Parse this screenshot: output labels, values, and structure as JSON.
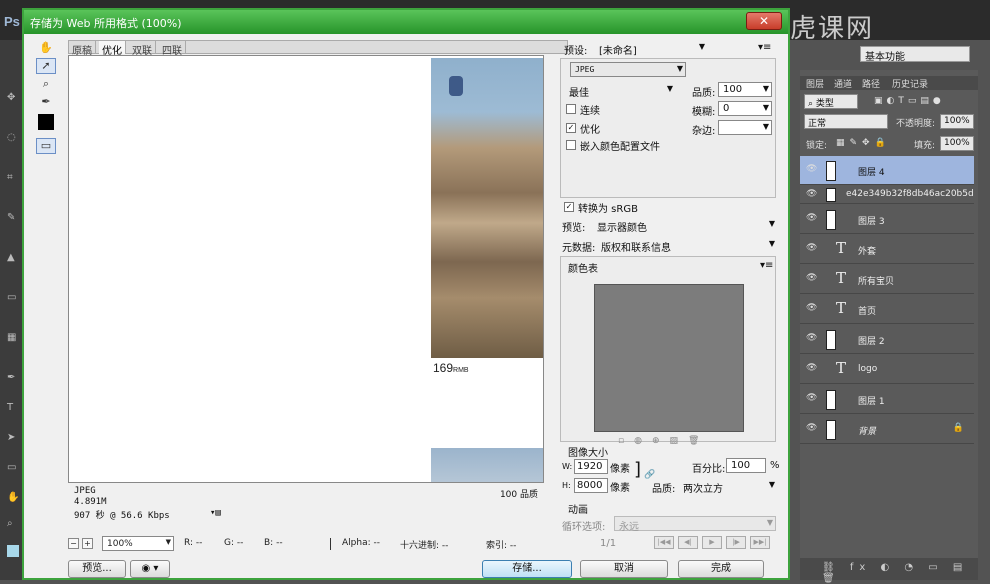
{
  "photoshop": {
    "logo": "Ps",
    "watermark": "虎课网",
    "workspace": "基本功能",
    "layers_panel": {
      "tabs": [
        "图层",
        "通道",
        "路径",
        "历史记录"
      ],
      "kind_filter": "类型",
      "blend_mode": "正常",
      "opacity_label": "不透明度:",
      "opacity_value": "100%",
      "lock_label": "锁定:",
      "fill_label": "填充:",
      "fill_value": "100%",
      "layers": [
        {
          "name": "图层 4",
          "type": "pixel",
          "selected": true
        },
        {
          "name": "e42e349b32f8db46ac20b5d",
          "type": "smart"
        },
        {
          "name": "图层 3",
          "type": "pixel"
        },
        {
          "name": "外套",
          "type": "text"
        },
        {
          "name": "所有宝贝",
          "type": "text"
        },
        {
          "name": "首页",
          "type": "text"
        },
        {
          "name": "图层 2",
          "type": "pixel"
        },
        {
          "name": "logo",
          "type": "text"
        },
        {
          "name": "图层 1",
          "type": "pixel"
        },
        {
          "name": "背景",
          "type": "background"
        }
      ],
      "bottom_icons": "⛓ fx ◐ ◔ ▭ ▤ 🗑"
    }
  },
  "dialog": {
    "title": "存储为 Web 所用格式 (100%)",
    "close": "✕",
    "preview_tabs": [
      "原稿",
      "优化",
      "双联",
      "四联"
    ],
    "active_tab": "优化",
    "preview": {
      "price": "169",
      "price_unit": "RMB"
    },
    "info": {
      "format": "JPEG",
      "size": "4.891M",
      "time": "907 秒 @ 56.6 Kbps",
      "quality": "100 品质"
    },
    "status": {
      "zoom": "100%",
      "r": "R: --",
      "g": "G: --",
      "b": "B: --",
      "alpha": "Alpha: --",
      "hex": "十六进制: --",
      "index": "索引: --"
    },
    "buttons": {
      "preview": "预览...",
      "save": "存储...",
      "cancel": "取消",
      "done": "完成"
    },
    "settings": {
      "preset_label": "预设:",
      "preset_value": "[未命名]",
      "format_value": "JPEG",
      "quality_level": "最佳",
      "quality_label": "品质:",
      "quality_value": "100",
      "progressive_label": "连续",
      "blur_label": "模糊:",
      "blur_value": "0",
      "optimized_label": "优化",
      "matte_label": "杂边:",
      "embed_profile_label": "嵌入颜色配置文件",
      "convert_srgb_label": "转换为 sRGB",
      "preview_label": "预览:",
      "preview_value": "显示器颜色",
      "metadata_label": "元数据:",
      "metadata_value": "版权和联系信息",
      "color_table_label": "颜色表",
      "image_size_label": "图像大小",
      "w_label": "W:",
      "w_value": "1920",
      "h_label": "H:",
      "h_value": "8000",
      "px_unit": "像素",
      "percent_label": "百分比:",
      "percent_value": "100",
      "percent_unit": "%",
      "resample_label": "品质:",
      "resample_value": "两次立方",
      "animation_label": "动画",
      "loop_label": "循环选项:",
      "loop_value": "永远",
      "frame_counter": "1/1"
    }
  }
}
